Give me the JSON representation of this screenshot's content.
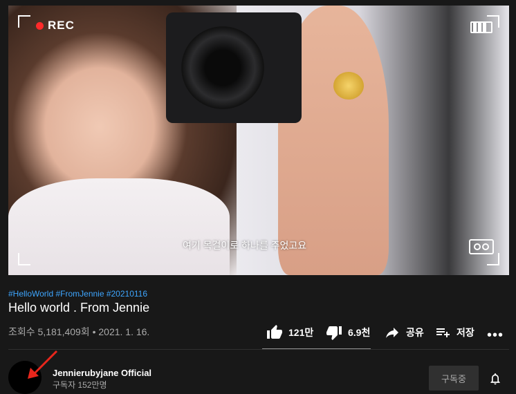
{
  "video": {
    "rec_label": "REC",
    "subtitle": "여기 목걸이로 하나를 주었고요"
  },
  "info": {
    "hashtags": "#HelloWorld #FromJennie #20210116",
    "title": "Hello world . From Jennie",
    "meta": "조회수 5,181,409회 • 2021. 1. 16."
  },
  "actions": {
    "like": "121만",
    "dislike": "6.9천",
    "share": "공유",
    "save": "저장",
    "more": "•••"
  },
  "channel": {
    "name": "Jennierubyjane Official",
    "subscribers": "구독자 152만명",
    "subscribe_label": "구독중"
  },
  "colors": {
    "background": "#181818",
    "hashtag": "#3ea6ff",
    "rec": "#ff2a2a",
    "annotation_arrow": "#e8261c"
  }
}
